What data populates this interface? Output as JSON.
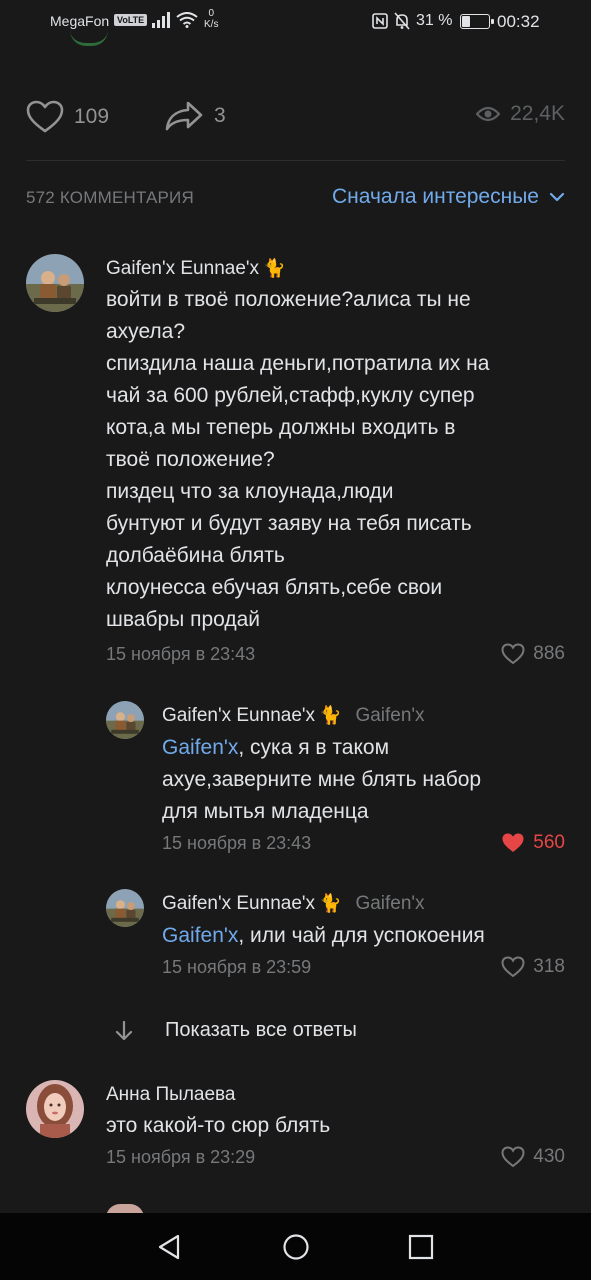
{
  "status_bar": {
    "carrier": "MegaFon",
    "volte": "VoLTE",
    "speed_value": "0",
    "speed_unit": "K/s",
    "battery_percent": "31 %",
    "battery_level": 0.31,
    "time": "00:32"
  },
  "post_actions": {
    "likes": "109",
    "shares": "3",
    "views": "22,4K"
  },
  "comments_header": {
    "count_label": "572 КОММЕНТАРИЯ",
    "sort_label": "Сначала интересные"
  },
  "comments": [
    {
      "author": "Gaifen'x Eunnae'x",
      "text_lines": [
        "войти в твоё положение?алиса ты не",
        "ахуела?",
        "спиздила наша деньги,потратила их на",
        "чай за 600 рублей,стафф,куклу супер",
        "кота,а мы теперь должны входить в",
        "твоё положение?",
        "пиздец что за клоунада,люди",
        "бунтуют и будут заяву на тебя писать",
        "долбаёбина блять",
        "клоунесса ебучая блять,себе свои",
        "швабры продай"
      ],
      "date": "15 ноября в 23:43",
      "likes": "886"
    }
  ],
  "replies": [
    {
      "author": "Gaifen'x Eunnae'x",
      "reply_to": "Gaifen'x",
      "mention": "Gaifen'x",
      "text_first": ", сука я в таком",
      "text_lines": [
        "ахуе,заверните мне блять набор",
        "для мытья младенца"
      ],
      "date": "15 ноября в 23:43",
      "likes": "560",
      "liked": true
    },
    {
      "author": "Gaifen'x Eunnae'x",
      "reply_to": "Gaifen'x",
      "mention": "Gaifen'x",
      "text_first": ", или чай для успокоения",
      "date": "15 ноября в 23:59",
      "likes": "318",
      "liked": false
    }
  ],
  "show_all_replies": "Показать все ответы",
  "second_comment": {
    "author": "Анна Пылаева",
    "text": "это какой-то сюр блять",
    "date": "15 ноября в 23:29",
    "likes": "430"
  },
  "colors": {
    "background": "#19191a",
    "accent": "#71aaeb",
    "like_active": "#e64646",
    "secondary_text": "#76787a"
  }
}
